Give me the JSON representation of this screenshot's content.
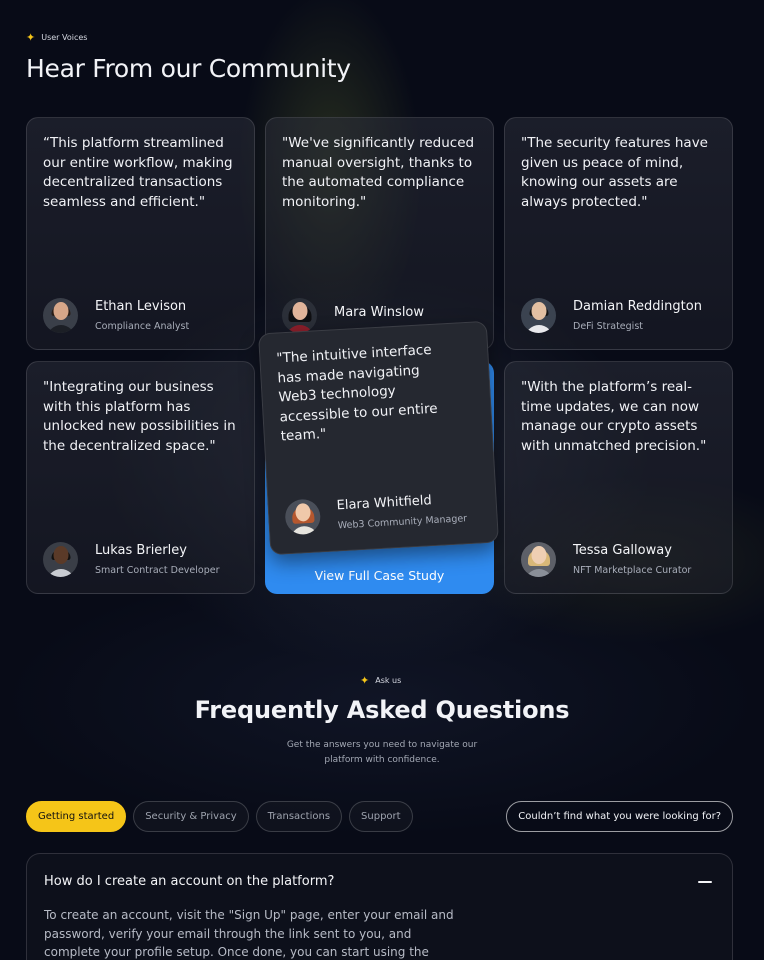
{
  "testimonials": {
    "eyebrow": "User Voices",
    "title": "Hear From our Community",
    "cards": [
      {
        "quote": "“This platform streamlined our entire workflow, making decentralized transactions seamless and efficient.\"",
        "name": "Ethan Levison",
        "role": "Compliance Analyst"
      },
      {
        "quote": "\"We've significantly reduced manual oversight, thanks to the automated compliance monitoring.\"",
        "name": "Mara Winslow",
        "role": ""
      },
      {
        "quote": "\"The security features have given us peace of mind, knowing our assets are always protected.\"",
        "name": "Damian Reddington",
        "role": "DeFi Strategist"
      },
      {
        "quote": "\"Integrating our business with this platform has unlocked new possibilities in the decentralized space.\"",
        "name": "Lukas Brierley",
        "role": "Smart Contract Developer"
      },
      {
        "quote": "\"The intuitive interface has made navigating Web3 technology accessible to our entire team.\"",
        "name": "Elara Whitfield",
        "role": "Web3 Community Manager"
      },
      {
        "quote": "\"With the platform’s real-time updates, we can now manage our crypto assets with unmatched precision.\"",
        "name": "Tessa Galloway",
        "role": "NFT Marketplace Curator"
      }
    ],
    "cta_label": "View Full Case Study"
  },
  "faq": {
    "eyebrow": "Ask us",
    "title": "Frequently Asked Questions",
    "subtitle_line1": "Get the answers you need to navigate our",
    "subtitle_line2": "platform with confidence.",
    "tabs": [
      "Getting started",
      "Security & Privacy",
      "Transactions",
      "Support"
    ],
    "active_tab": "Getting started",
    "help_label": "Couldn’t find what you were looking for?",
    "items": [
      {
        "question": "How do I create an account on the platform?",
        "answer": "To create an account, visit the \"Sign Up\" page, enter your email and password, verify your email through the link sent to you, and complete your profile setup. Once done, you can start using the platform."
      }
    ]
  },
  "colors": {
    "accent_yellow": "#f5c518",
    "cta_blue": "#2f8bf0",
    "background": "#080b17"
  },
  "icons": {
    "eyebrow": "sparkle-icon",
    "faq_toggle": "minus-icon"
  }
}
